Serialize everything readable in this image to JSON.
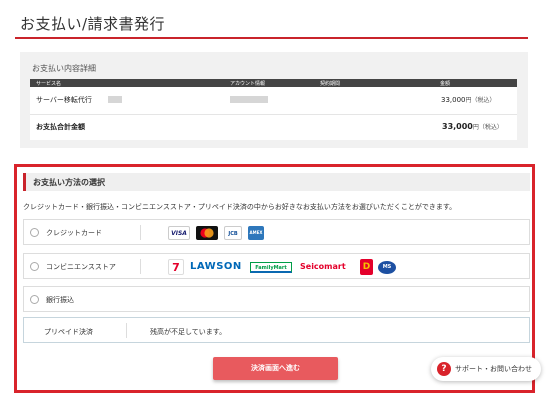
{
  "page": {
    "title": "お支払い/請求書発行"
  },
  "summary": {
    "heading": "お支払い内容詳細",
    "columns": [
      "サービス名",
      "アカウント情報",
      "契約期間",
      "金額"
    ],
    "items": [
      {
        "service": "サーバー移転代行",
        "amount": "33,000",
        "tax": "円（税込）"
      }
    ],
    "total_label": "お支払合計金額",
    "total_amount": "33,000",
    "total_tax": "円（税込）"
  },
  "method": {
    "heading": "お支払い方法の選択",
    "description": "クレジットカード・銀行振込・コンビニエンスストア・プリペイド決済の中からお好きなお支払い方法をお選びいただくことができます。",
    "options": [
      {
        "label": "クレジットカード",
        "logos": [
          "VISA",
          "Mastercard",
          "JCB",
          "American Express"
        ]
      },
      {
        "label": "コンビニエンスストア",
        "logos": [
          "7-Eleven",
          "LAWSON",
          "FamilyMart",
          "Seicomart",
          "Daily Yamazaki",
          "Ministop"
        ]
      },
      {
        "label": "銀行振込"
      }
    ],
    "prepaid_label": "プリペイド決済",
    "prepaid_message": "残高が不足しています。",
    "proceed_button": "決済画面へ進む"
  },
  "logos": {
    "visa": "VISA",
    "jcb": "JCB",
    "amex": "AMEX",
    "lawson": "LAWSON",
    "familymart": "FamilyMart",
    "seicomart": "Seicomart",
    "seven": "7",
    "daily": "D",
    "ministop": "MS"
  },
  "support": {
    "label": "サポート・お問い合わせ",
    "icon": "?"
  },
  "colors": {
    "accent": "#d9232b",
    "button": "#e85a5e",
    "panel": "#f1f1f1"
  }
}
